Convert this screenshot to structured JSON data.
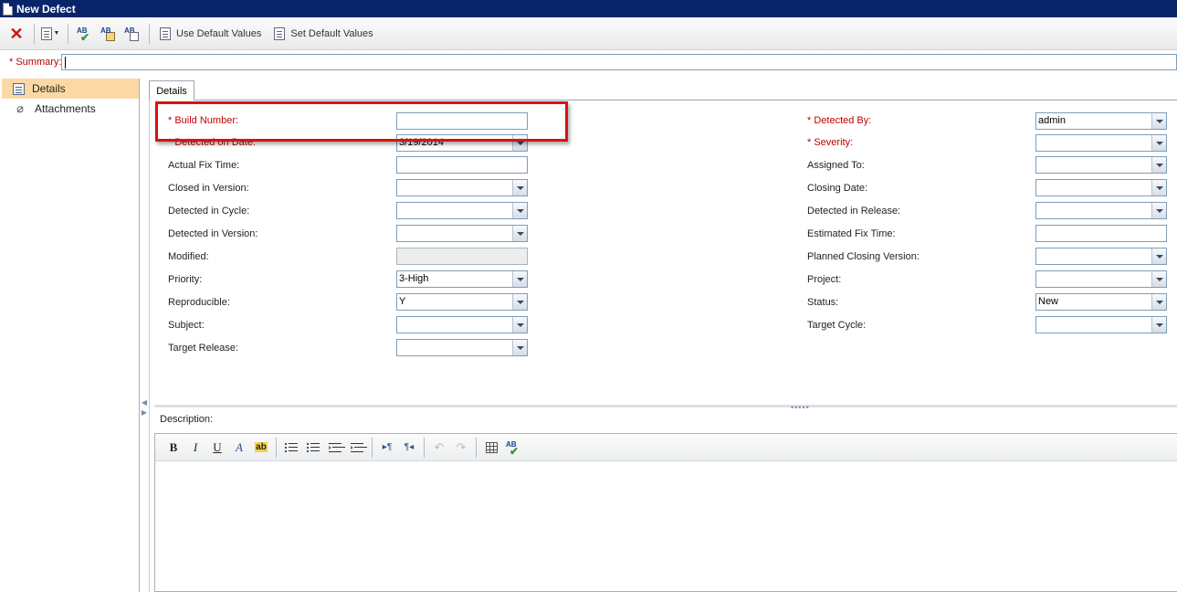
{
  "window": {
    "title": "New Defect"
  },
  "toolbar": {
    "use_default_values": "Use Default Values",
    "set_default_values": "Set Default Values"
  },
  "summary": {
    "label": "* Summary:",
    "value": ""
  },
  "sidebar": {
    "items": [
      {
        "label": "Details",
        "active": true,
        "icon": "details-icon"
      },
      {
        "label": "Attachments",
        "active": false,
        "icon": "paperclip-icon"
      }
    ]
  },
  "tab": {
    "label": "Details"
  },
  "fields_left": [
    {
      "label": "* Build Number:",
      "value": "",
      "required": true,
      "type": "text"
    },
    {
      "label": "* Detected on Date:",
      "value": "3/19/2014",
      "required": true,
      "type": "dropdown"
    },
    {
      "label": "Actual Fix Time:",
      "value": "",
      "required": false,
      "type": "text"
    },
    {
      "label": "Closed in Version:",
      "value": "",
      "required": false,
      "type": "dropdown"
    },
    {
      "label": "Detected in Cycle:",
      "value": "",
      "required": false,
      "type": "dropdown"
    },
    {
      "label": "Detected in Version:",
      "value": "",
      "required": false,
      "type": "dropdown"
    },
    {
      "label": "Modified:",
      "value": "",
      "required": false,
      "type": "readonly"
    },
    {
      "label": "Priority:",
      "value": "3-High",
      "required": false,
      "type": "dropdown"
    },
    {
      "label": "Reproducible:",
      "value": "Y",
      "required": false,
      "type": "dropdown"
    },
    {
      "label": "Subject:",
      "value": "",
      "required": false,
      "type": "dropdown"
    },
    {
      "label": "Target Release:",
      "value": "",
      "required": false,
      "type": "dropdown"
    }
  ],
  "fields_right": [
    {
      "label": "* Detected By:",
      "value": "admin",
      "required": true,
      "type": "dropdown"
    },
    {
      "label": "* Severity:",
      "value": "",
      "required": true,
      "type": "dropdown"
    },
    {
      "label": "Assigned To:",
      "value": "",
      "required": false,
      "type": "dropdown"
    },
    {
      "label": "Closing Date:",
      "value": "",
      "required": false,
      "type": "dropdown"
    },
    {
      "label": "Detected in Release:",
      "value": "",
      "required": false,
      "type": "dropdown"
    },
    {
      "label": "Estimated Fix Time:",
      "value": "",
      "required": false,
      "type": "text"
    },
    {
      "label": "Planned Closing Version:",
      "value": "",
      "required": false,
      "type": "dropdown"
    },
    {
      "label": "Project:",
      "value": "",
      "required": false,
      "type": "dropdown"
    },
    {
      "label": "Status:",
      "value": "New",
      "required": false,
      "type": "dropdown"
    },
    {
      "label": "Target Cycle:",
      "value": "",
      "required": false,
      "type": "dropdown"
    }
  ],
  "description": {
    "label": "Description:",
    "toolbar": {
      "bold": "B",
      "italic": "I",
      "underline": "U",
      "font_color": "A",
      "highlight": "ab",
      "ltr": "▸¶",
      "rtl": "¶◂"
    },
    "value": ""
  },
  "colors": {
    "titlebar": "#0a246a",
    "required_label": "#c00000",
    "active_sidebar": "#fcd9a4",
    "highlight_box": "#dd1111"
  }
}
